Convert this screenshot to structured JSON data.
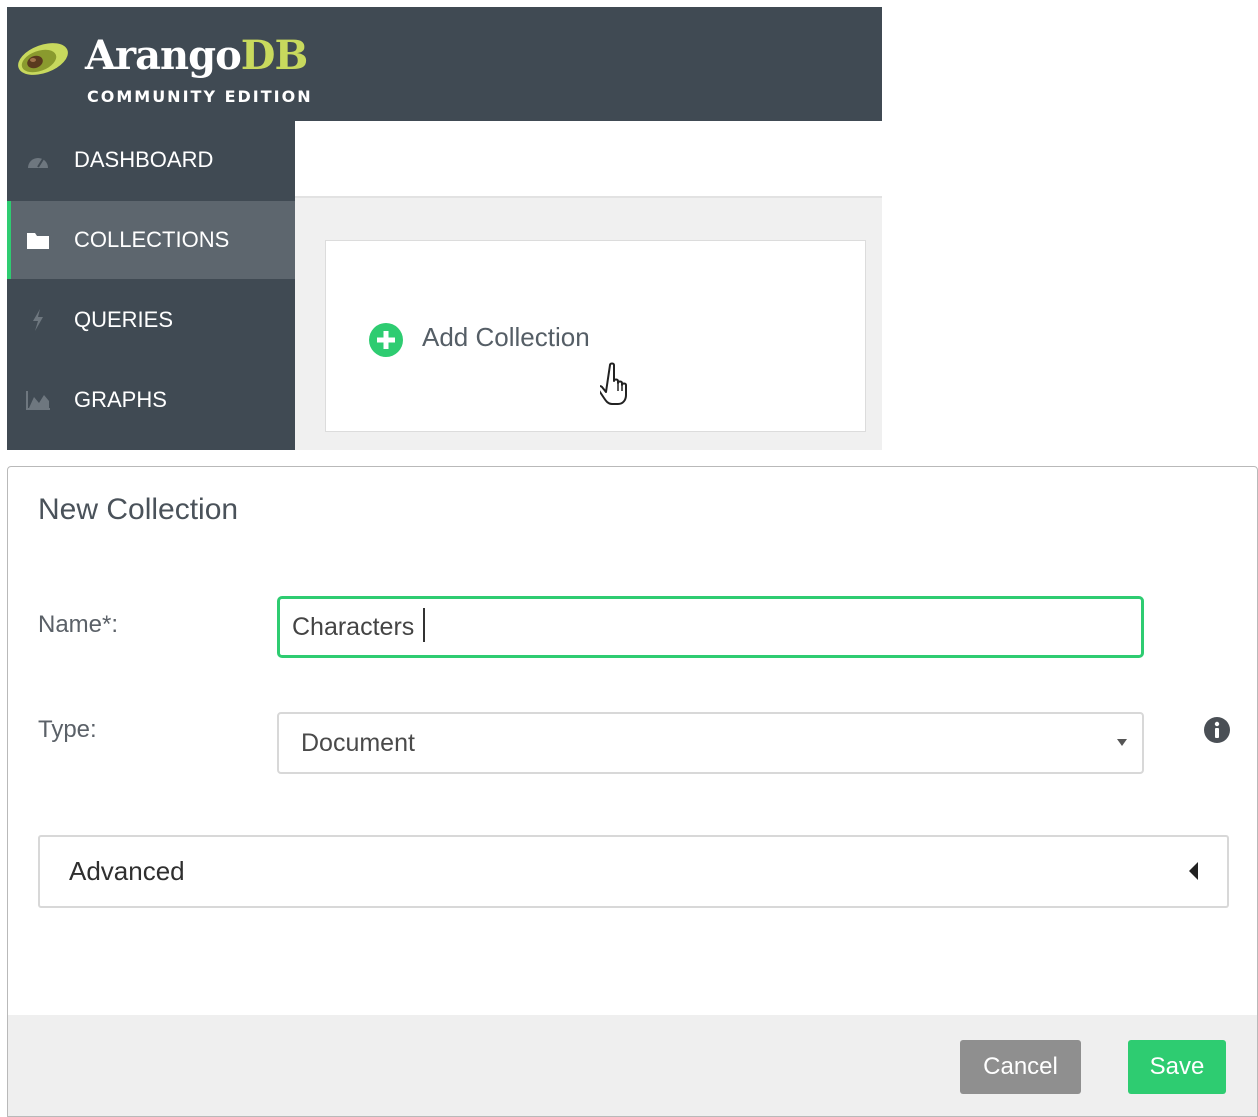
{
  "app": {
    "brand_name": "Arango",
    "brand_suffix": "DB",
    "edition": "COMMUNITY EDITION"
  },
  "sidebar": {
    "items": [
      {
        "label": "DASHBOARD",
        "icon": "dashboard-gauge-icon",
        "active": false
      },
      {
        "label": "COLLECTIONS",
        "icon": "folder-icon",
        "active": true
      },
      {
        "label": "QUERIES",
        "icon": "lightning-icon",
        "active": false
      },
      {
        "label": "GRAPHS",
        "icon": "area-chart-icon",
        "active": false
      }
    ]
  },
  "collections_page": {
    "add_card_label": "Add Collection"
  },
  "modal": {
    "title": "New Collection",
    "name_label": "Name*:",
    "name_value": "Characters",
    "type_label": "Type:",
    "type_value": "Document",
    "advanced_label": "Advanced",
    "cancel_label": "Cancel",
    "save_label": "Save"
  },
  "colors": {
    "sidebar_bg": "#404a53",
    "active_item_bg": "#5d666e",
    "accent_green": "#2ecc71",
    "brand_lime": "#c8d95d",
    "cancel_gray": "#8f8f8f"
  }
}
